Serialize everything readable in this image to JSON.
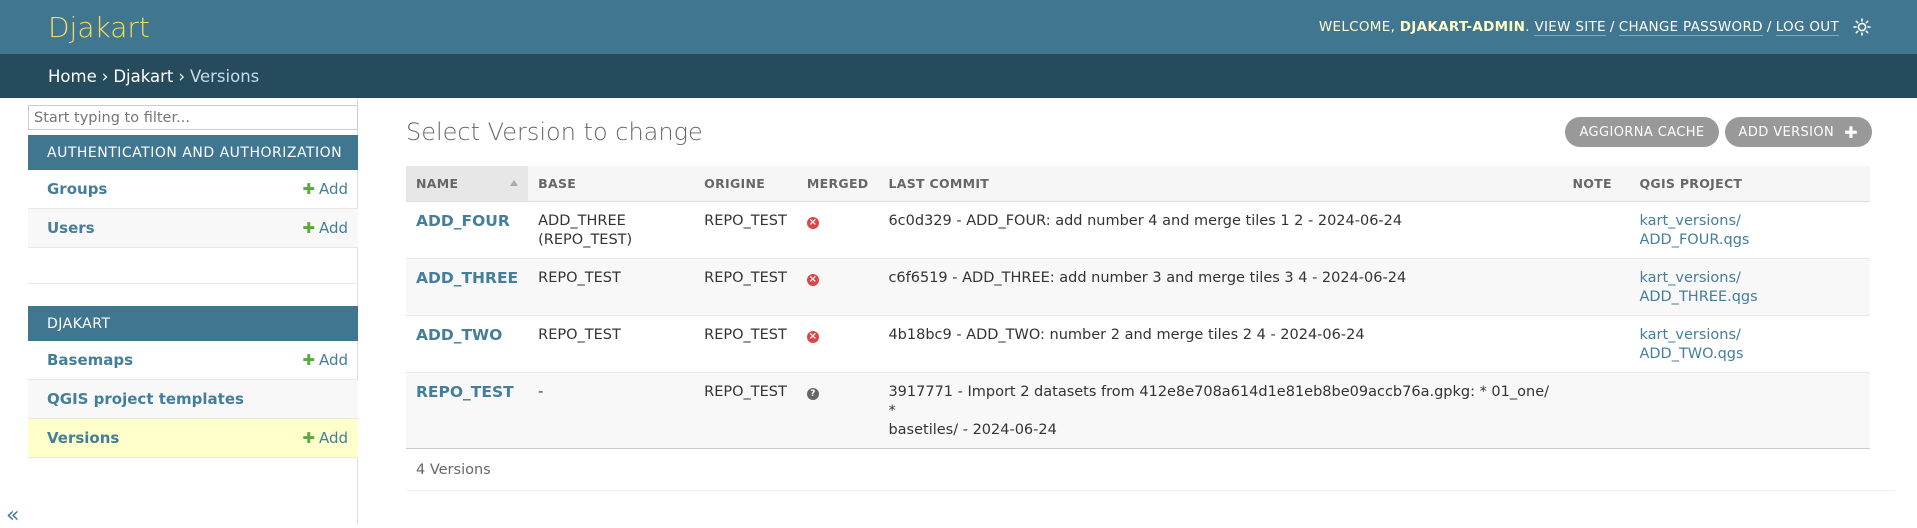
{
  "header": {
    "brand": "Djakart",
    "welcome_prefix": "WELCOME,",
    "username": "DJAKART-ADMIN",
    "view_site": "VIEW SITE",
    "change_password": "CHANGE PASSWORD",
    "log_out": "LOG OUT",
    "sep": "/",
    "theme_icon": "sun-icon"
  },
  "breadcrumbs": {
    "home": "Home",
    "app": "Djakart",
    "current": "Versions",
    "arrow": "›"
  },
  "sidebar": {
    "filter_placeholder": "Start typing to filter...",
    "add_label": "Add",
    "collapse_label": "«",
    "auth": {
      "caption": "AUTHENTICATION AND AUTHORIZATION",
      "items": [
        {
          "label": "Groups",
          "has_add": true
        },
        {
          "label": "Users",
          "has_add": true
        }
      ]
    },
    "djakart": {
      "caption": "DJAKART",
      "items": [
        {
          "label": "Basemaps",
          "has_add": true
        },
        {
          "label": "QGIS project templates",
          "has_add": false
        },
        {
          "label": "Versions",
          "has_add": true,
          "current": true
        }
      ]
    }
  },
  "content": {
    "title": "Select Version to change",
    "buttons": {
      "refresh_cache": "AGGIORNA CACHE",
      "add_version": "ADD VERSION"
    },
    "columns": [
      "NAME",
      "BASE",
      "ORIGINE",
      "MERGED",
      "LAST COMMIT",
      "NOTE",
      "QGIS PROJECT"
    ],
    "rows": [
      {
        "name": "ADD_FOUR",
        "base": "ADD_THREE (REPO_TEST)",
        "origine": "REPO_TEST",
        "merged": "no",
        "last_commit": "6c0d329 - ADD_FOUR: add number 4 and merge tiles 1 2 - 2024-06-24",
        "note": "",
        "qgis_line1": "kart_versions/",
        "qgis_line2": "ADD_FOUR.qgs"
      },
      {
        "name": "ADD_THREE",
        "base": "REPO_TEST",
        "origine": "REPO_TEST",
        "merged": "no",
        "last_commit": "c6f6519 - ADD_THREE: add number 3 and merge tiles 3 4 - 2024-06-24",
        "note": "",
        "qgis_line1": "kart_versions/",
        "qgis_line2": "ADD_THREE.qgs"
      },
      {
        "name": "ADD_TWO",
        "base": "REPO_TEST",
        "origine": "REPO_TEST",
        "merged": "no",
        "last_commit": "4b18bc9 - ADD_TWO: number 2 and merge tiles 2 4 - 2024-06-24",
        "note": "",
        "qgis_line1": "kart_versions/",
        "qgis_line2": "ADD_TWO.qgs"
      },
      {
        "name": "REPO_TEST",
        "base": "-",
        "origine": "REPO_TEST",
        "merged": "unknown",
        "last_commit_line1": "3917771 - Import 2 datasets from 412e8e708a614d1e81eb8be09accb76a.gpkg: * 01_one/ *",
        "last_commit_line2": "basetiles/ - 2024-06-24",
        "note": "",
        "qgis_line1": "",
        "qgis_line2": ""
      }
    ],
    "count_label": "4 Versions"
  },
  "colors": {
    "header_bg": "#417690",
    "breadcrumbs_bg": "#264b5d",
    "brand": "#f5dd5d",
    "link": "#447e9b",
    "add_plus": "#5aa940",
    "current_row": "#ffffcc",
    "merged_no": "#dd4646"
  }
}
